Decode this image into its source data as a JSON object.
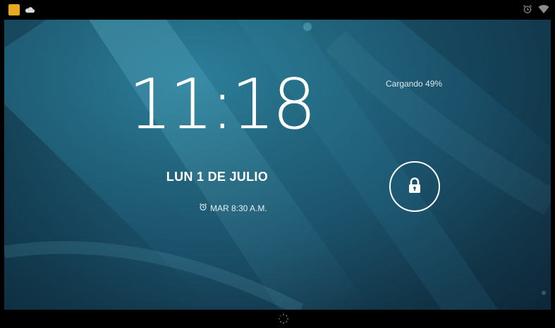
{
  "status_bar": {
    "left_icons": [
      "app-notification-icon",
      "cloud-icon"
    ],
    "right_icons": [
      "alarm-icon",
      "wifi-icon"
    ]
  },
  "lockscreen": {
    "time": "11:18",
    "date": "LUN 1 DE JULIO",
    "alarm_text": "MAR 8:30 A.M.",
    "charging_text": "Cargando 49%",
    "lock_icon": "lock-icon"
  },
  "nav_bar": {
    "icon": "loading-spinner-icon"
  },
  "colors": {
    "background": "#000000",
    "wallpaper_accent": "#2c7e9b",
    "text": "#ffffff"
  }
}
